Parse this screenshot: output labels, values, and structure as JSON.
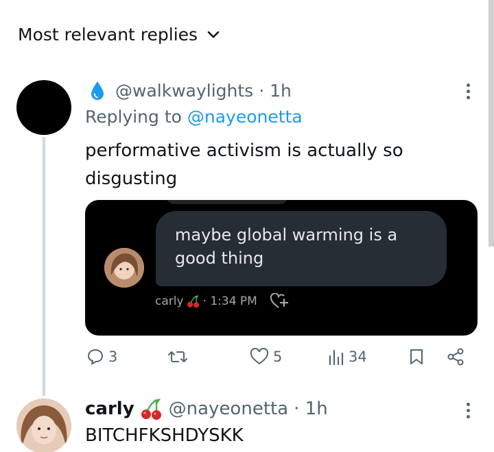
{
  "header": {
    "title": "Most relevant replies"
  },
  "reply": {
    "handle": "@walkwaylights",
    "time": "· 1h",
    "replying_prefix": "Replying to ",
    "replying_handle": "@nayeonetta",
    "text": "performative activism is actually so disgusting",
    "screenshot": {
      "message": "maybe global warming is a good thing",
      "sender": "carly",
      "sent_time": "· 1:34 PM"
    },
    "actions": {
      "replies": "3",
      "likes": "5",
      "views": "34"
    }
  },
  "next_reply": {
    "name": "carly",
    "handle": "@nayeonetta",
    "time": "· 1h",
    "text": "BITCHFKSHDYSKK"
  },
  "colors": {
    "accent": "#1d9bf0",
    "muted": "#536471",
    "text": "#0f1419"
  }
}
